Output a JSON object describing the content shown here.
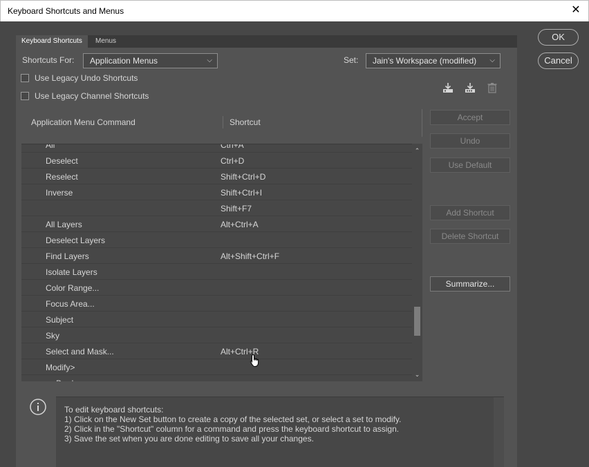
{
  "window": {
    "title": "Keyboard Shortcuts and Menus"
  },
  "tabs": [
    {
      "label": "Keyboard Shortcuts",
      "active": true
    },
    {
      "label": "Menus",
      "active": false
    }
  ],
  "shortcuts_for": {
    "label": "Shortcuts For:",
    "value": "Application Menus"
  },
  "set": {
    "label": "Set:",
    "value": "Jain's Workspace (modified)"
  },
  "checkboxes": {
    "legacy_undo": {
      "label": "Use Legacy Undo Shortcuts",
      "checked": false
    },
    "legacy_channel": {
      "label": "Use Legacy Channel Shortcuts",
      "checked": false
    }
  },
  "table": {
    "col_command": "Application Menu Command",
    "col_shortcut": "Shortcut",
    "rows": [
      {
        "command": "All",
        "shortcut": "Ctrl+A",
        "sub": false
      },
      {
        "command": "Deselect",
        "shortcut": "Ctrl+D",
        "sub": false
      },
      {
        "command": "Reselect",
        "shortcut": "Shift+Ctrl+D",
        "sub": false
      },
      {
        "command": "Inverse",
        "shortcut": "Shift+Ctrl+I",
        "sub": false
      },
      {
        "command": "",
        "shortcut": "Shift+F7",
        "sub": false
      },
      {
        "command": "All Layers",
        "shortcut": "Alt+Ctrl+A",
        "sub": false
      },
      {
        "command": "Deselect Layers",
        "shortcut": "",
        "sub": false
      },
      {
        "command": "Find Layers",
        "shortcut": "Alt+Shift+Ctrl+F",
        "sub": false
      },
      {
        "command": "Isolate Layers",
        "shortcut": "",
        "sub": false
      },
      {
        "command": "Color Range...",
        "shortcut": "",
        "sub": false
      },
      {
        "command": "Focus Area...",
        "shortcut": "",
        "sub": false
      },
      {
        "command": "Subject",
        "shortcut": "",
        "sub": false
      },
      {
        "command": "Sky",
        "shortcut": "",
        "sub": false
      },
      {
        "command": "Select and Mask...",
        "shortcut": "Alt+Ctrl+R",
        "sub": false
      },
      {
        "command": "Modify>",
        "shortcut": "",
        "sub": false
      },
      {
        "command": "Border...",
        "shortcut": "",
        "sub": true
      }
    ]
  },
  "side_buttons": {
    "accept": "Accept",
    "undo": "Undo",
    "use_default": "Use Default",
    "add_shortcut": "Add Shortcut",
    "delete_shortcut": "Delete Shortcut",
    "summarize": "Summarize..."
  },
  "dialog_buttons": {
    "ok": "OK",
    "cancel": "Cancel"
  },
  "info": {
    "line1": "To edit keyboard shortcuts:",
    "line2": "1) Click on the New Set button to create a copy of the selected set, or select a set to modify.",
    "line3": "2) Click in the \"Shortcut\" column for a command and press the keyboard shortcut to assign.",
    "line4": "3) Save the set when you are done editing to save all your changes."
  },
  "icons": {
    "save_set": "save-set-icon",
    "new_set": "new-set-icon",
    "delete_set": "trash-icon",
    "info": "info-icon",
    "close": "close-icon"
  },
  "colors": {
    "background": "#474747",
    "panel": "#535353",
    "text": "#d6d6d6",
    "disabled_text": "#8a8a8a"
  }
}
